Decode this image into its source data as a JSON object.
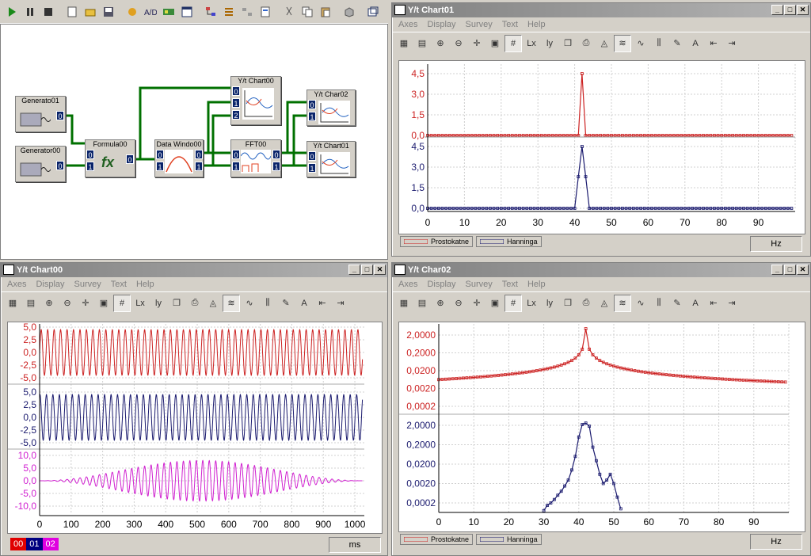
{
  "main_toolbar": {
    "icons": [
      "play-icon",
      "pause-icon",
      "stop-icon",
      "new-icon",
      "open-icon",
      "save-icon",
      "hand-icon",
      "ad-icon",
      "card-icon",
      "window-icon",
      "tree-icon",
      "list-icon",
      "align-icon",
      "props-icon",
      "cut-icon",
      "copy-icon",
      "paste-icon",
      "cube-icon",
      "restore-icon"
    ]
  },
  "diagram": {
    "blocks": [
      {
        "name": "Generator01",
        "label": "Generato01",
        "ports": [
          "0"
        ]
      },
      {
        "name": "Generator00",
        "label": "Generator00",
        "ports": [
          "0"
        ]
      },
      {
        "name": "Formula00",
        "label": "Formula00",
        "inputs": [
          "0",
          "1"
        ],
        "outputs": [
          "0"
        ]
      },
      {
        "name": "DataWindow00",
        "label": "Data Windo00",
        "inputs": [
          "0",
          "1"
        ],
        "outputs": [
          "0",
          "1"
        ]
      },
      {
        "name": "FFT00",
        "label": "FFT00",
        "inputs": [
          "0",
          "1"
        ],
        "outputs": [
          "0",
          "1"
        ]
      },
      {
        "name": "YtChart00",
        "label": "Y/t Chart00",
        "inputs": [
          "0",
          "1",
          "2"
        ]
      },
      {
        "name": "YtChar02",
        "label": "Y/t Char02",
        "inputs": [
          "0",
          "1"
        ]
      },
      {
        "name": "YtChart01",
        "label": "Y/t Chart01",
        "inputs": [
          "0",
          "1"
        ]
      }
    ]
  },
  "menu": [
    "Axes",
    "Display",
    "Survey",
    "Text",
    "Help"
  ],
  "win_chart01": {
    "title": "Y/t Chart01",
    "unit": "Hz",
    "legend": [
      "Prostokatne",
      "Hanninga"
    ],
    "top_ticks": [
      "4,5",
      "3,0",
      "1,5",
      "0,0"
    ],
    "bottom_ticks": [
      "4,5",
      "3,0",
      "1,5",
      "0,0"
    ],
    "x_ticks": [
      "0",
      "10",
      "20",
      "30",
      "40",
      "50",
      "60",
      "70",
      "80",
      "90"
    ]
  },
  "win_chart00": {
    "title": "Y/t Chart00",
    "unit": "ms",
    "channels": [
      "00",
      "01",
      "02"
    ],
    "ticks_a": [
      "5,0",
      "2,5",
      "0,0",
      "-2,5",
      "-5,0"
    ],
    "ticks_b": [
      "5,0",
      "2,5",
      "0,0",
      "-2,5",
      "-5,0"
    ],
    "ticks_c": [
      "10,0",
      "5,0",
      "0,0",
      "-5,0",
      "-10,0"
    ],
    "x_ticks": [
      "0",
      "100",
      "200",
      "300",
      "400",
      "500",
      "600",
      "700",
      "800",
      "900",
      "1000"
    ]
  },
  "win_chart02": {
    "title": "Y/t Char02",
    "unit": "Hz",
    "legend": [
      "Prostokatne",
      "Hanninga"
    ],
    "top_ticks": [
      "2,0000",
      "0,2000",
      "0,0200",
      "0,0020",
      "0,0002"
    ],
    "bottom_ticks": [
      "2,0000",
      "0,2000",
      "0,0200",
      "0,0020",
      "0,0002"
    ],
    "x_ticks": [
      "0",
      "10",
      "20",
      "30",
      "40",
      "50",
      "60",
      "70",
      "80",
      "90"
    ]
  },
  "colors": {
    "red": "#cc2222",
    "navy": "#1a1a6e",
    "magenta": "#d020d0",
    "grid": "#c0c0c0",
    "green": "#007000"
  }
}
